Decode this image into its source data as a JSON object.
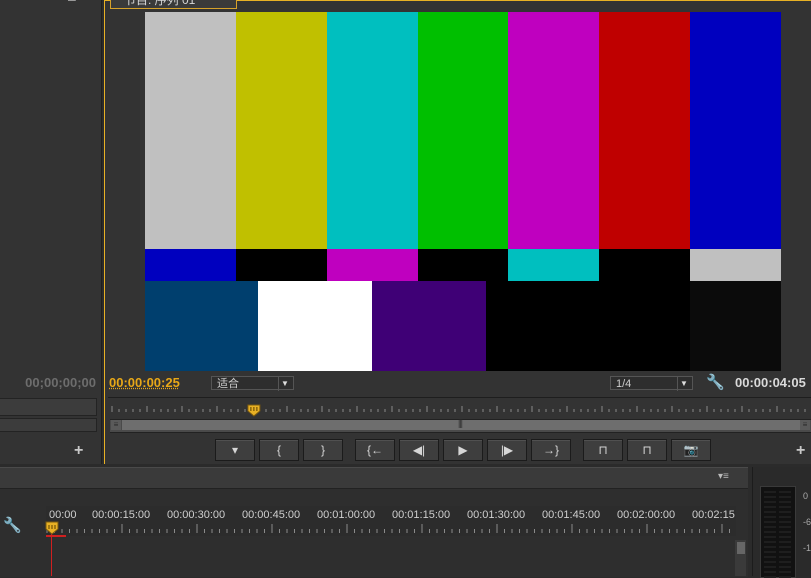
{
  "source_panel": {
    "timecode": "00;00;00;00",
    "add_label": "+",
    "minimize_label": "–"
  },
  "program_monitor": {
    "tab_label": "节目: 序列 01",
    "tab_menu": "▾",
    "tab_close": "×",
    "color_bars": {
      "top": [
        "#c0c0c0",
        "#c0c000",
        "#00bfbf",
        "#00bf00",
        "#bf00bf",
        "#bf0000",
        "#0000bf"
      ],
      "middle": [
        "#0000bf",
        "#000000",
        "#bf00bf",
        "#000000",
        "#00bfbf",
        "#000000",
        "#c0c0c0"
      ],
      "bottom": [
        "#003f6e",
        "#ffffff",
        "#3f0076",
        "#000000",
        "#000000",
        "#0b0b0b",
        "#000000"
      ]
    },
    "current_timecode": "00:00:00:25",
    "fit_select": "适合",
    "resolution_select": "1/4",
    "duration_timecode": "00:00:04:05",
    "add_label": "+",
    "playhead_fraction": 0.203,
    "transport": [
      {
        "name": "add-marker-button",
        "glyph": "▾"
      },
      {
        "name": "mark-in-button",
        "glyph": "{"
      },
      {
        "name": "mark-out-button",
        "glyph": "}"
      },
      {
        "name": "go-to-in-button",
        "glyph": "{←"
      },
      {
        "name": "step-back-button",
        "glyph": "◀|"
      },
      {
        "name": "play-button",
        "glyph": "▶"
      },
      {
        "name": "step-forward-button",
        "glyph": "|▶"
      },
      {
        "name": "go-to-out-button",
        "glyph": "→}"
      },
      {
        "name": "lift-button",
        "glyph": "⊓"
      },
      {
        "name": "extract-button",
        "glyph": "⊓"
      },
      {
        "name": "export-frame-button",
        "glyph": "📷"
      }
    ]
  },
  "timeline": {
    "menu_glyph": "▾≡",
    "ruler_labels": [
      "00:00",
      "00:00:15:00",
      "00:00:30:00",
      "00:00:45:00",
      "00:01:00:00",
      "00:01:15:00",
      "00:01:30:00",
      "00:01:45:00",
      "00:02:00:00",
      "00:02:15"
    ]
  },
  "audio_meter": {
    "db_labels": [
      "0",
      "-6",
      "-1"
    ]
  }
}
